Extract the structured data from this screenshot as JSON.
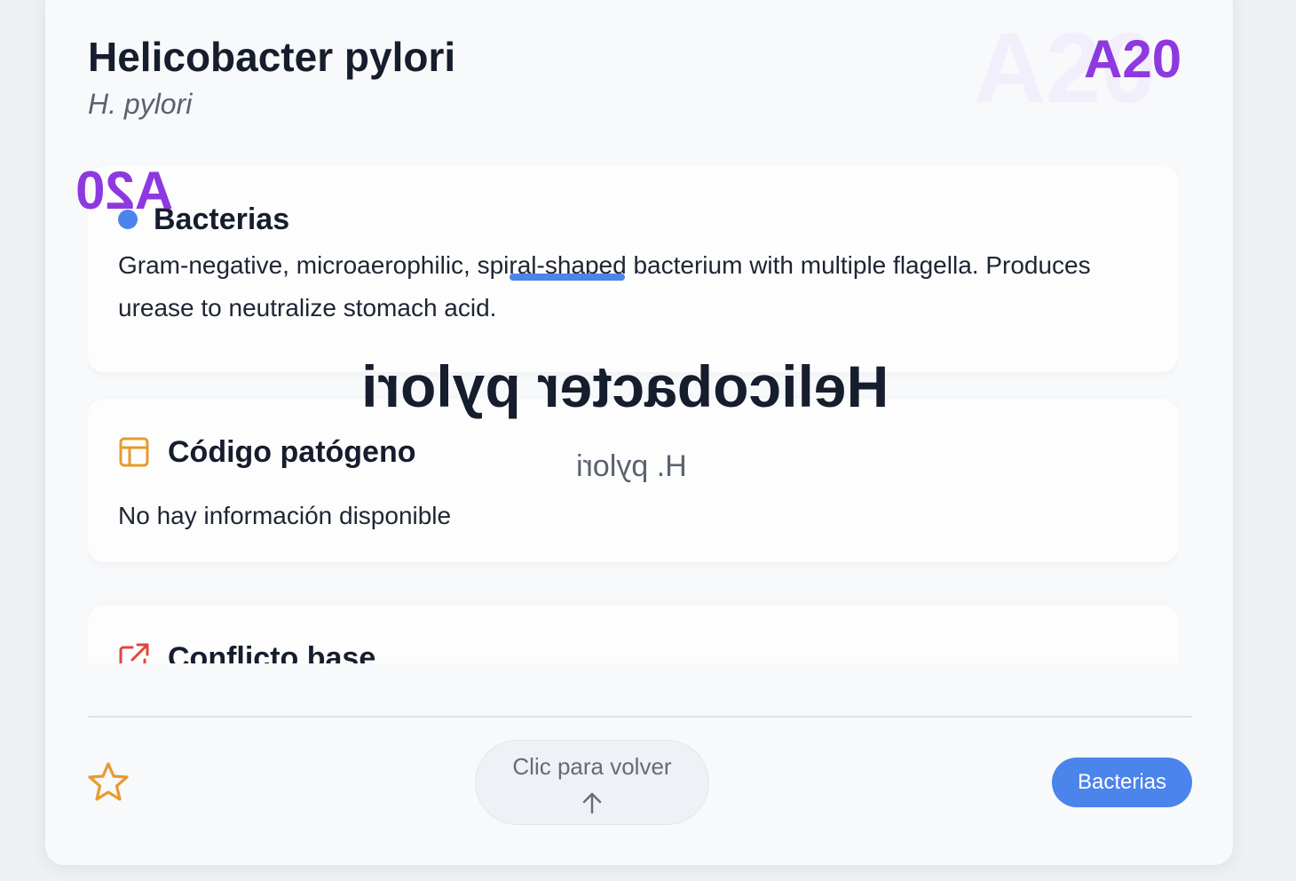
{
  "card": {
    "title": "Helicobacter pylori",
    "subtitle": "H. pylori",
    "code": "A20"
  },
  "sections": [
    {
      "heading": "Bacterias",
      "body_before": "Gram-negative, microaerophilic, ",
      "body_highlight": "spiral-shaped",
      "body_after": " bacterium with multiple flagella. Produces urease to neutralize stomach acid."
    },
    {
      "heading": "Código patógeno",
      "body": "No hay información disponible"
    },
    {
      "heading": "Conflicto base"
    }
  ],
  "footer": {
    "flip_label": "Clic para volver",
    "category": "Bacterias"
  },
  "colors": {
    "accent": "#4b84ea",
    "code": "#8d39df",
    "star": "#e89a2c",
    "pathogen_icon": "#e89a2c",
    "conflict_icon": "#e0473a"
  },
  "icons": {
    "favorite": "star-icon",
    "pathogen": "table-icon",
    "conflict": "external-link-icon",
    "flip": "arrow-up-icon"
  }
}
